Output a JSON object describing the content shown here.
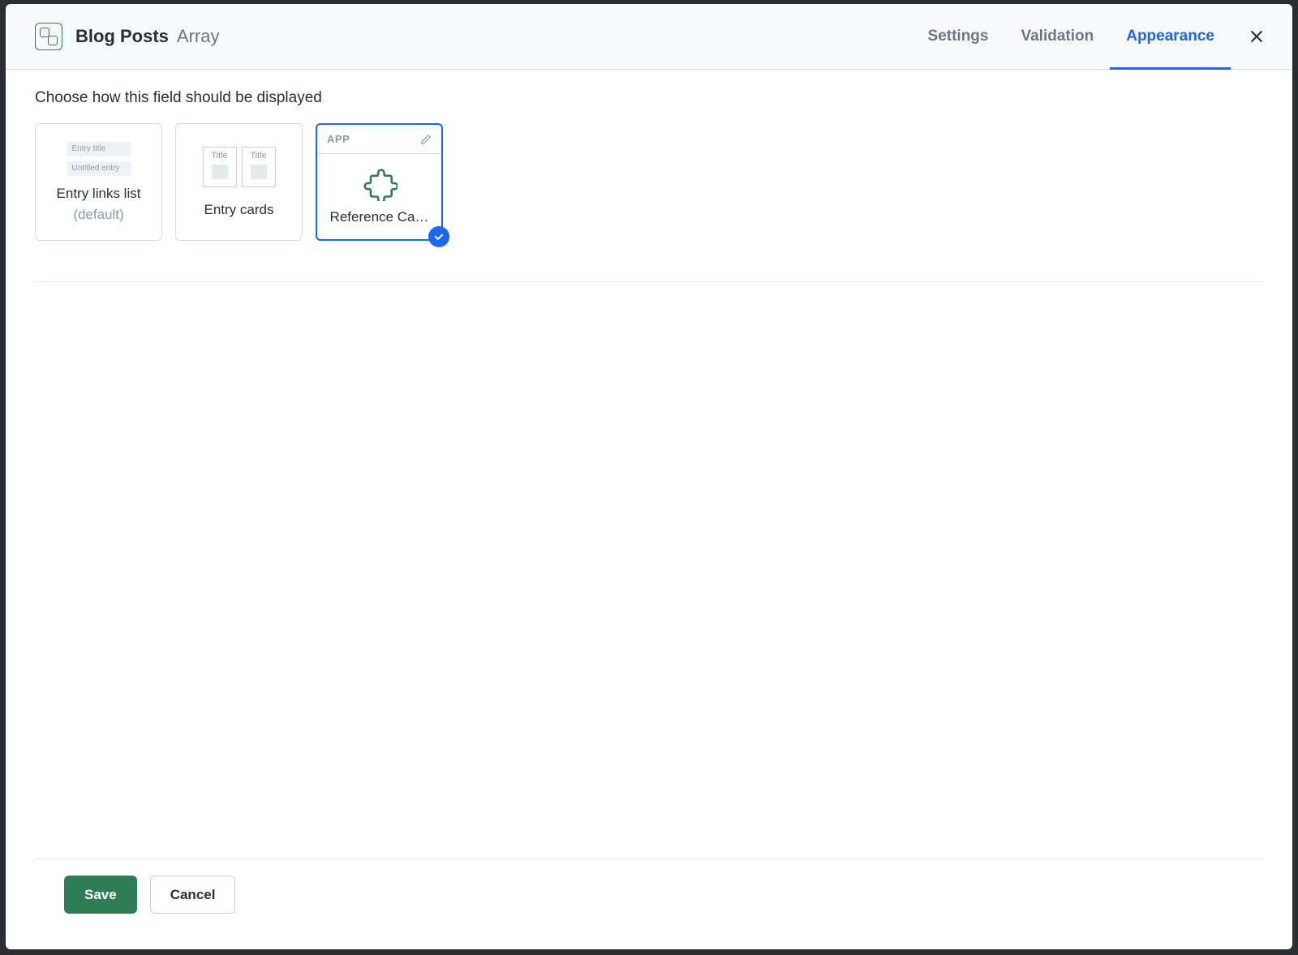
{
  "header": {
    "field_name": "Blog Posts",
    "field_type": "Array"
  },
  "tabs": {
    "settings": "Settings",
    "validation": "Validation",
    "appearance": "Appearance"
  },
  "body": {
    "section_label": "Choose how this field should be displayed",
    "options": {
      "entry_links_list": {
        "label": "Entry links list",
        "sublabel": "(default)",
        "preview_line1": "Entry title",
        "preview_line2": "Untitled entry"
      },
      "entry_cards": {
        "label": "Entry cards",
        "card_title": "Title"
      },
      "reference_cards": {
        "badge": "APP",
        "label": "Reference Ca…"
      }
    }
  },
  "footer": {
    "save": "Save",
    "cancel": "Cancel"
  }
}
